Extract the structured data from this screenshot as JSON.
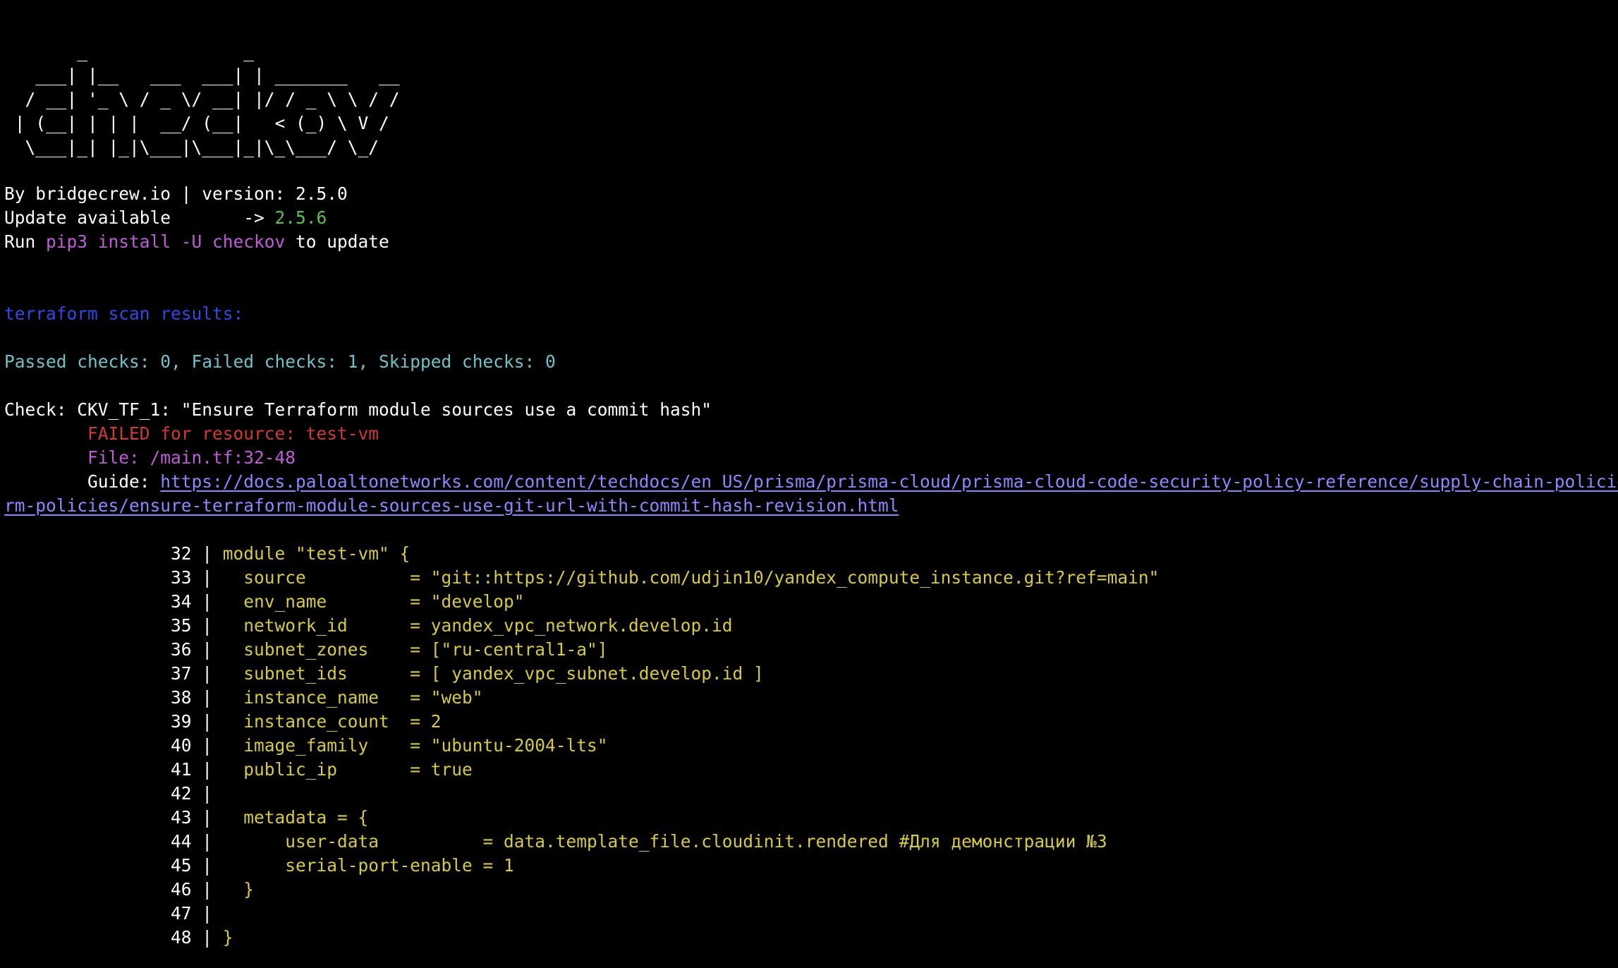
{
  "banner": {
    "lines": [
      "       _               _",
      "   ___| |__   ___  ___| | _______   __",
      "  / __| '_ \\ / _ \\/ __| |/ / _ \\ \\ / /",
      " | (__| | | |  __/ (__|   < (_) \\ V /",
      "  \\___|_| |_|\\___|\\___|_|\\_\\___/ \\_/"
    ]
  },
  "header": {
    "by_line": "By bridgecrew.io | version: 2.5.0",
    "update_label": "Update available       -> ",
    "update_version": "2.5.6",
    "run_prefix": "Run ",
    "run_command": "pip3 install -U checkov",
    "run_suffix": " to update"
  },
  "scan": {
    "title": "terraform scan results:",
    "summary": "Passed checks: 0, Failed checks: 1, Skipped checks: 0"
  },
  "check": {
    "title_line": "Check: CKV_TF_1: \"Ensure Terraform module sources use a commit hash\"",
    "failed_line": "        FAILED for resource: test-vm",
    "file_line": "        File: /main.tf:32-48",
    "guide_label": "        Guide: ",
    "guide_url_part1": "https://docs.paloaltonetworks.com/content/techdocs/en_US/prisma/prisma-cloud/prisma-cloud-code-security-policy-reference/supply-chain-policies/terrafo",
    "guide_url_part2": "rm-policies/ensure-terraform-module-sources-use-git-url-with-commit-hash-revision.html"
  },
  "code": {
    "lines": [
      {
        "num": "32",
        "text": "module \"test-vm\" {"
      },
      {
        "num": "33",
        "text": "  source          = \"git::https://github.com/udjin10/yandex_compute_instance.git?ref=main\""
      },
      {
        "num": "34",
        "text": "  env_name        = \"develop\""
      },
      {
        "num": "35",
        "text": "  network_id      = yandex_vpc_network.develop.id"
      },
      {
        "num": "36",
        "text": "  subnet_zones    = [\"ru-central1-a\"]"
      },
      {
        "num": "37",
        "text": "  subnet_ids      = [ yandex_vpc_subnet.develop.id ]"
      },
      {
        "num": "38",
        "text": "  instance_name   = \"web\""
      },
      {
        "num": "39",
        "text": "  instance_count  = 2"
      },
      {
        "num": "40",
        "text": "  image_family    = \"ubuntu-2004-lts\""
      },
      {
        "num": "41",
        "text": "  public_ip       = true"
      },
      {
        "num": "42",
        "text": ""
      },
      {
        "num": "43",
        "text": "  metadata = {"
      },
      {
        "num": "44",
        "text": "      user-data          = data.template_file.cloudinit.rendered #Для демонстрации №3"
      },
      {
        "num": "45",
        "text": "      serial-port-enable = 1"
      },
      {
        "num": "46",
        "text": "  }"
      },
      {
        "num": "47",
        "text": ""
      },
      {
        "num": "48",
        "text": "}"
      }
    ]
  },
  "colors": {
    "background": "#000000",
    "text": "#ffffff",
    "green": "#5ac24b",
    "magenta": "#c05cd8",
    "blue": "#2f4be6",
    "cyan": "#6fc3c9",
    "red": "#d13a34",
    "link": "#8f87ff",
    "code": "#d6c946"
  }
}
